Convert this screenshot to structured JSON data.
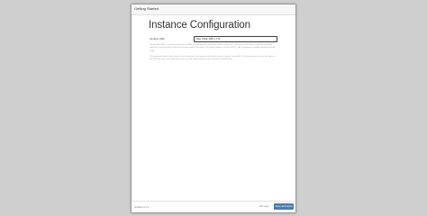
{
  "dialog": {
    "title": "Getting Started"
  },
  "main": {
    "heading": "Instance Configuration",
    "url_label": "Jenkins URL:",
    "url_value": "http://192.168.1.7:8/",
    "help_paragraph_1": "The Jenkins URL is used to provide the root URL for absolute links to various Jenkins resources. That means this value is required for proper operation of many Jenkins features including email notifications, PR status updates, and the BUILD_URL environment variable provided to build steps.",
    "help_paragraph_2": "The proposed default value shown is not saved yet and is generated from the current request, if possible. The best practice is to set this value to the URL that users are expected to use. This will avoid confusion when sharing or viewing links."
  },
  "footer": {
    "version": "Jenkins 2.x.x",
    "not_now_label": "Not now",
    "save_label": "Save and Finish"
  },
  "colors": {
    "primary_button": "#4c7cae",
    "background": "#cfcfcf"
  }
}
